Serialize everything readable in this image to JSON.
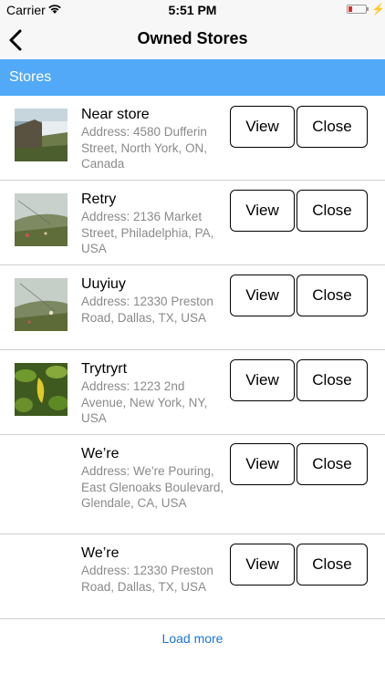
{
  "status": {
    "carrier": "Carrier",
    "time": "5:51 PM"
  },
  "nav": {
    "title": "Owned Stores"
  },
  "section": {
    "title": "Stores"
  },
  "stores": [
    {
      "name": "Near store",
      "address": "Address: 4580 Dufferin Street, North York, ON, Canada",
      "image": "waterfall-photo",
      "view_label": "View",
      "close_label": "Close"
    },
    {
      "name": "Retry",
      "address": "Address: 2136 Market Street, Philadelphia, PA, USA",
      "image": "grass-photo",
      "view_label": "View",
      "close_label": "Close"
    },
    {
      "name": "Uuyiuy",
      "address": "Address: 12330 Preston Road, Dallas, TX, USA",
      "image": "grass-photo",
      "view_label": "View",
      "close_label": "Close"
    },
    {
      "name": "Trytryrt",
      "address": "Address: 1223 2nd Avenue, New York, NY, USA",
      "image": "pepper-plant-photo",
      "view_label": "View",
      "close_label": "Close"
    },
    {
      "name": "We’re",
      "address": "Address: We're Pouring, East Glenoaks Boulevard, Glendale, CA, USA",
      "image": "",
      "view_label": "View",
      "close_label": "Close"
    },
    {
      "name": "We’re",
      "address": "Address: 12330 Preston Road, Dallas, TX, USA",
      "image": "",
      "view_label": "View",
      "close_label": "Close"
    }
  ],
  "load_more": "Load more",
  "colors": {
    "section_bg": "#52a9f7",
    "link": "#1d74d6",
    "address_text": "#8a8a8a",
    "battery": "#e12b2b"
  }
}
